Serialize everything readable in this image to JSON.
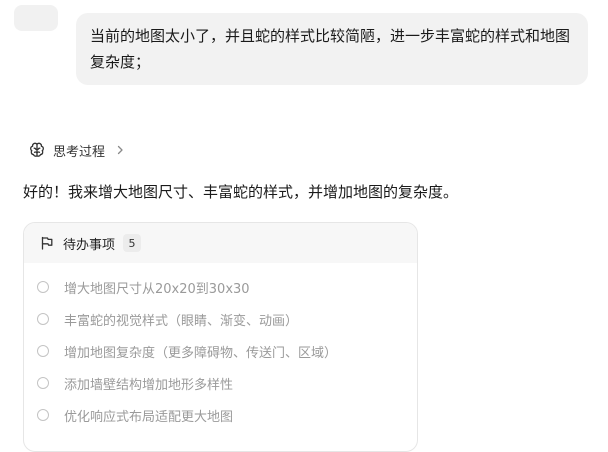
{
  "user_message": {
    "text": "当前的地图太小了，并且蛇的样式比较简陋，进一步丰富蛇的样式和地图复杂度；"
  },
  "thinking": {
    "label": "思考过程",
    "icon": "brain-icon",
    "chevron_icon": "chevron-right-icon"
  },
  "assistant_reply": {
    "text": "好的！我来增大地图尺寸、丰富蛇的样式，并增加地图的复杂度。"
  },
  "todo": {
    "title": "待办事项",
    "count": "5",
    "icon": "flag-icon",
    "items": [
      {
        "label": "增大地图尺寸从20x20到30x30",
        "status": "pending"
      },
      {
        "label": "丰富蛇的视觉样式（眼睛、渐变、动画）",
        "status": "pending"
      },
      {
        "label": "增加地图复杂度（更多障碍物、传送门、区域）",
        "status": "pending"
      },
      {
        "label": "添加墙壁结构增加地形多样性",
        "status": "pending"
      },
      {
        "label": "优化响应式布局适配更大地图",
        "status": "pending"
      }
    ]
  },
  "colors": {
    "user_bubble_bg": "#f2f2f2",
    "todo_header_bg": "#f7f7f7",
    "pending_text": "#9a9a9a"
  }
}
